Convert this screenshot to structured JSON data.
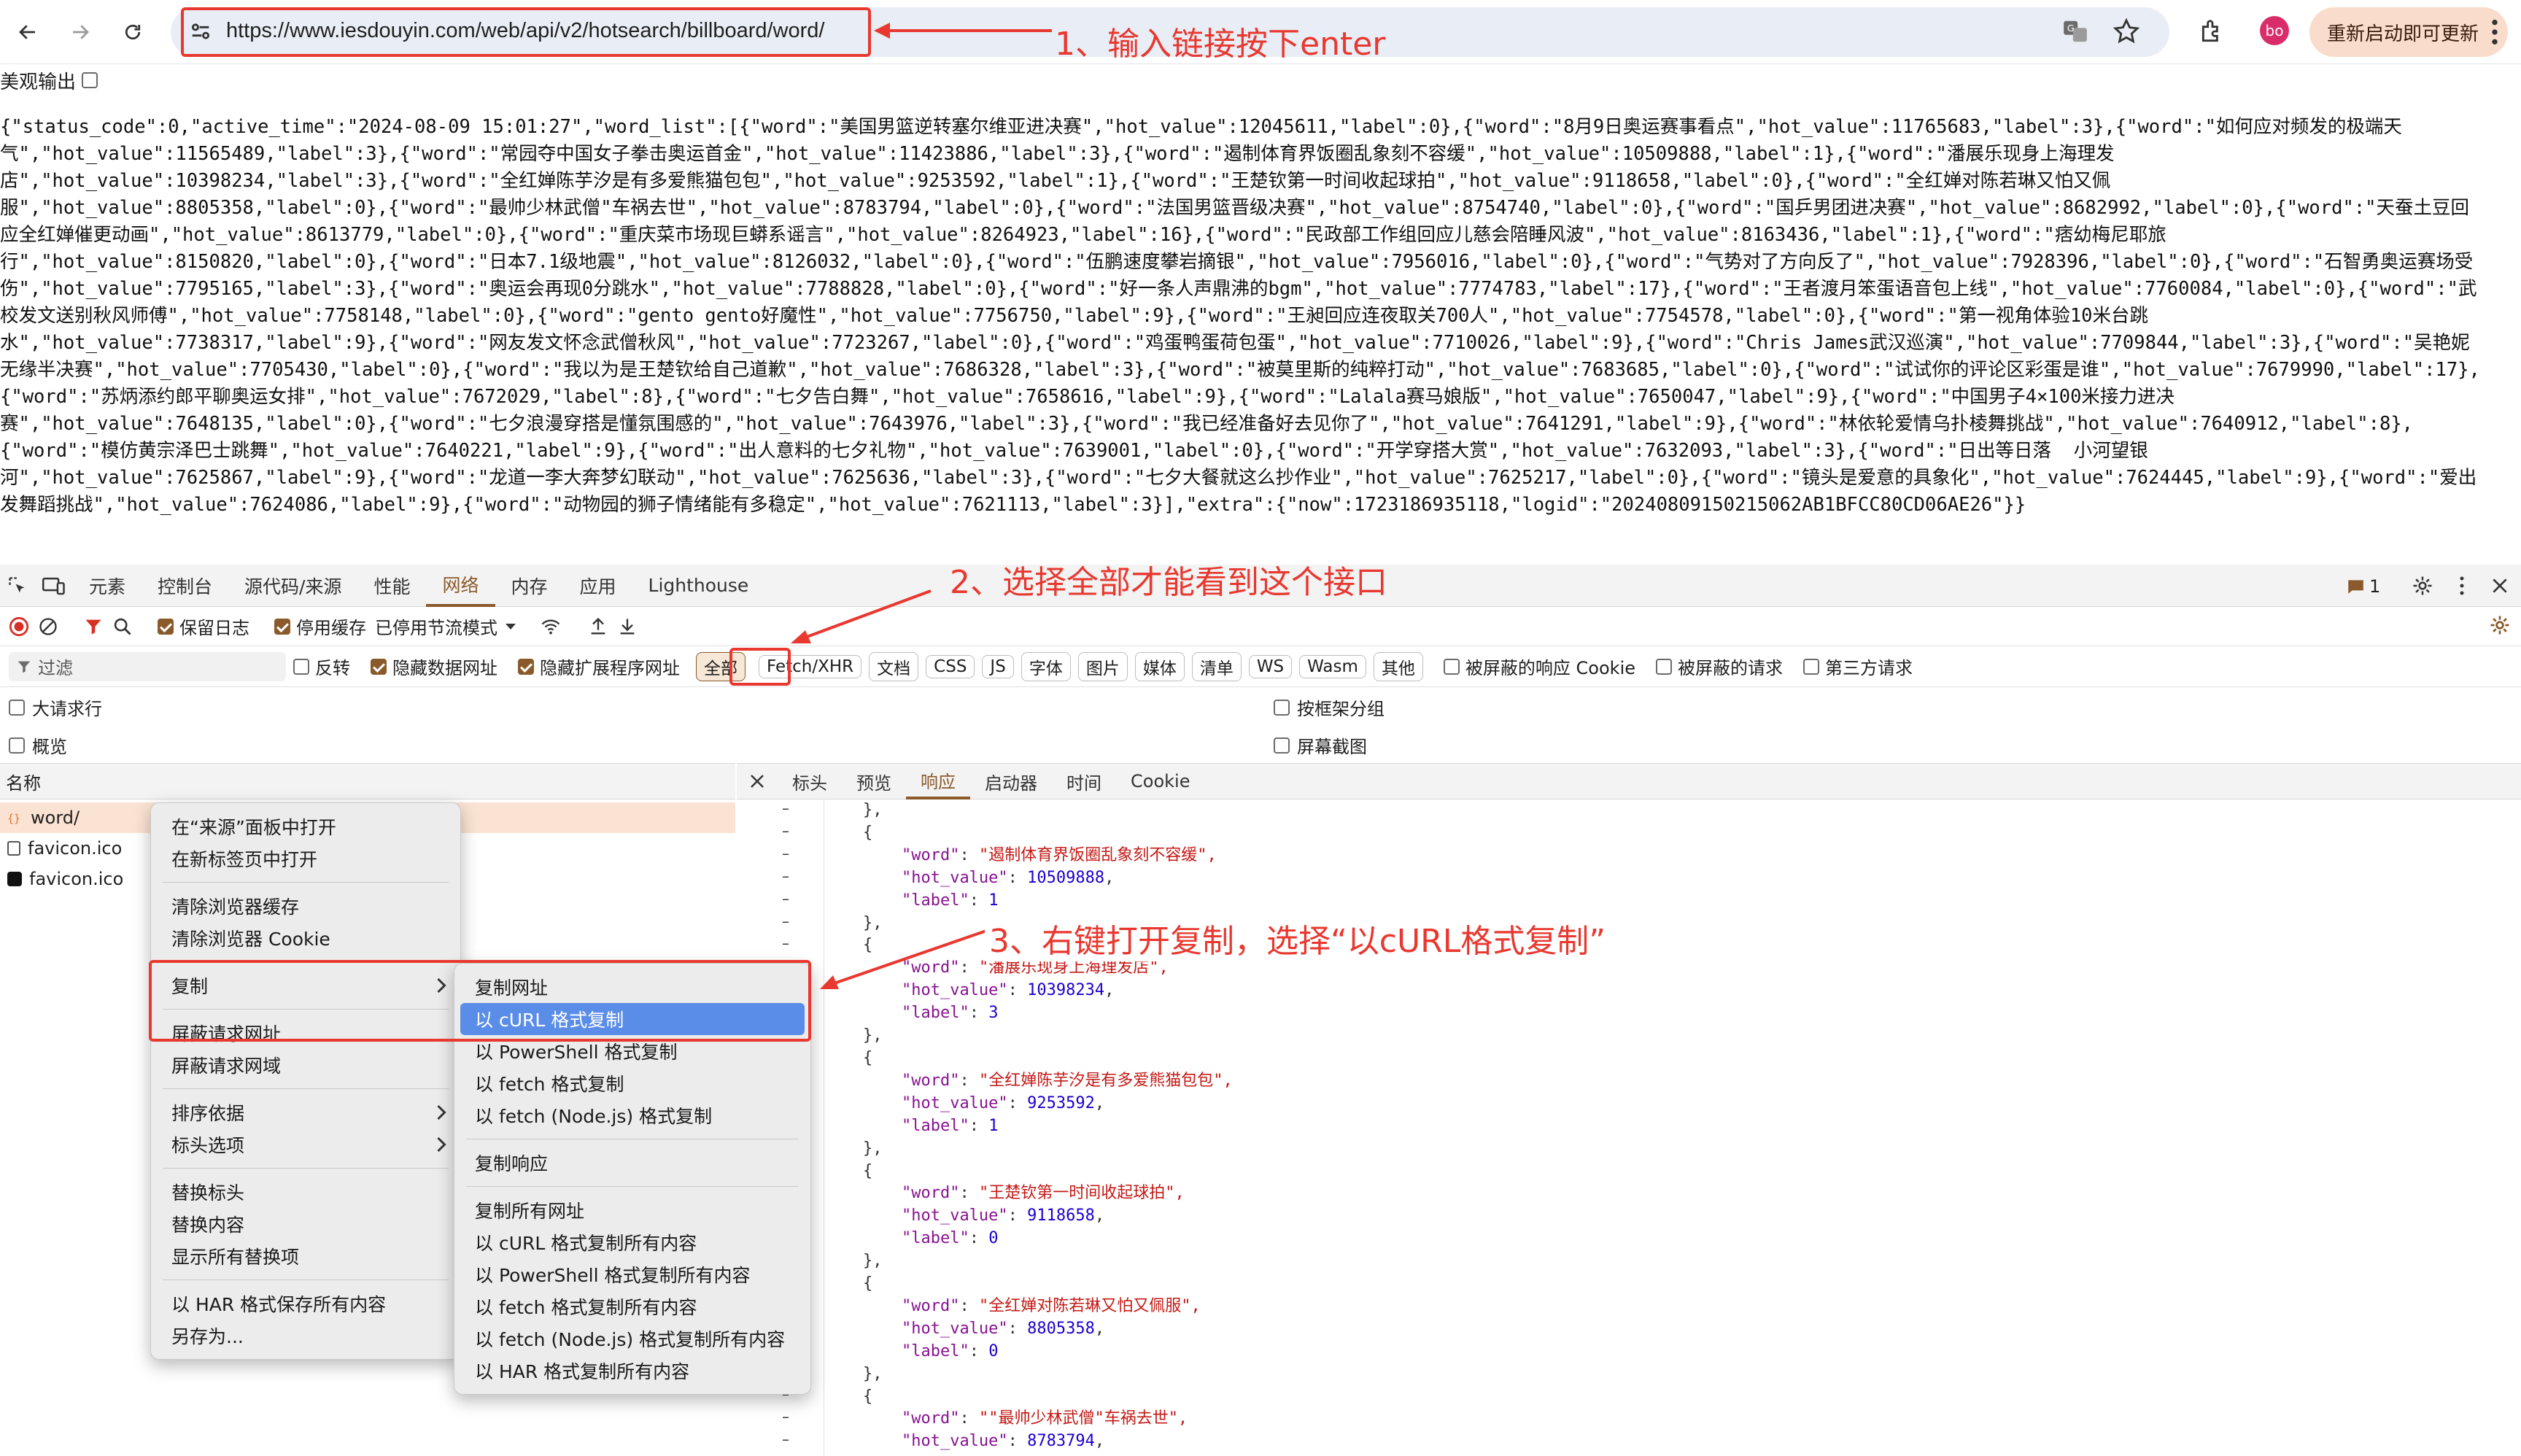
{
  "browser": {
    "url": "https://www.iesdouyin.com/web/api/v2/hotsearch/billboard/word/",
    "avatar_initials": "bo",
    "update_button": "重新启动即可更新"
  },
  "pretty_print": {
    "label": "美观输出"
  },
  "raw_json_lines": [
    "{\"status_code\":0,\"active_time\":\"2024-08-09 15:01:27\",\"word_list\":[{\"word\":\"美国男篮逆转塞尔维亚进决赛\",\"hot_value\":12045611,\"label\":0},{\"word\":\"8月9日奥运赛事看点\",\"hot_value\":11765683,\"label\":3},{\"word\":\"如何应对频发的极端天",
    "气\",\"hot_value\":11565489,\"label\":3},{\"word\":\"常园夺中国女子拳击奥运首金\",\"hot_value\":11423886,\"label\":3},{\"word\":\"遏制体育界饭圈乱象刻不容缓\",\"hot_value\":10509888,\"label\":1},{\"word\":\"潘展乐现身上海理发",
    "店\",\"hot_value\":10398234,\"label\":3},{\"word\":\"全红婵陈芋汐是有多爱熊猫包包\",\"hot_value\":9253592,\"label\":1},{\"word\":\"王楚钦第一时间收起球拍\",\"hot_value\":9118658,\"label\":0},{\"word\":\"全红婵对陈若琳又怕又佩",
    "服\",\"hot_value\":8805358,\"label\":0},{\"word\":\"最帅少林武僧\"车祸去世\",\"hot_value\":8783794,\"label\":0},{\"word\":\"法国男篮晋级决赛\",\"hot_value\":8754740,\"label\":0},{\"word\":\"国乒男团进决赛\",\"hot_value\":8682992,\"label\":0},{\"word\":\"天蚕土豆回",
    "应全红婵催更动画\",\"hot_value\":8613779,\"label\":0},{\"word\":\"重庆菜市场现巨蟒系谣言\",\"hot_value\":8264923,\"label\":16},{\"word\":\"民政部工作组回应儿慈会陪睡风波\",\"hot_value\":8163436,\"label\":1},{\"word\":\"痞幼梅尼耶旅",
    "行\",\"hot_value\":8150820,\"label\":0},{\"word\":\"日本7.1级地震\",\"hot_value\":8126032,\"label\":0},{\"word\":\"伍鹏速度攀岩摘银\",\"hot_value\":7956016,\"label\":0},{\"word\":\"气势对了方向反了\",\"hot_value\":7928396,\"label\":0},{\"word\":\"石智勇奥运赛场受",
    "伤\",\"hot_value\":7795165,\"label\":3},{\"word\":\"奥运会再现0分跳水\",\"hot_value\":7788828,\"label\":0},{\"word\":\"好一条人声鼎沸的bgm\",\"hot_value\":7774783,\"label\":17},{\"word\":\"王者渡月笨蛋语音包上线\",\"hot_value\":7760084,\"label\":0},{\"word\":\"武",
    "校发文送别秋风师傅\",\"hot_value\":7758148,\"label\":0},{\"word\":\"gento gento好魔性\",\"hot_value\":7756750,\"label\":9},{\"word\":\"王昶回应连夜取关700人\",\"hot_value\":7754578,\"label\":0},{\"word\":\"第一视角体验10米台跳",
    "水\",\"hot_value\":7738317,\"label\":9},{\"word\":\"网友发文怀念武僧秋风\",\"hot_value\":7723267,\"label\":0},{\"word\":\"鸡蛋鸭蛋荷包蛋\",\"hot_value\":7710026,\"label\":9},{\"word\":\"Chris James武汉巡演\",\"hot_value\":7709844,\"label\":3},{\"word\":\"吴艳妮",
    "无缘半决赛\",\"hot_value\":7705430,\"label\":0},{\"word\":\"我以为是王楚钦给自己道歉\",\"hot_value\":7686328,\"label\":3},{\"word\":\"被莫里斯的纯粹打动\",\"hot_value\":7683685,\"label\":0},{\"word\":\"试试你的评论区彩蛋是谁\",\"hot_value\":7679990,\"label\":17},",
    "{\"word\":\"苏炳添约郎平聊奥运女排\",\"hot_value\":7672029,\"label\":8},{\"word\":\"七夕告白舞\",\"hot_value\":7658616,\"label\":9},{\"word\":\"Lalala赛马娘版\",\"hot_value\":7650047,\"label\":9},{\"word\":\"中国男子4×100米接力进决",
    "赛\",\"hot_value\":7648135,\"label\":0},{\"word\":\"七夕浪漫穿搭是懂氛围感的\",\"hot_value\":7643976,\"label\":3},{\"word\":\"我已经准备好去见你了\",\"hot_value\":7641291,\"label\":9},{\"word\":\"林依轮爱情乌扑棱舞挑战\",\"hot_value\":7640912,\"label\":8},",
    "{\"word\":\"模仿黄宗泽巴士跳舞\",\"hot_value\":7640221,\"label\":9},{\"word\":\"出人意料的七夕礼物\",\"hot_value\":7639001,\"label\":0},{\"word\":\"开学穿搭大赏\",\"hot_value\":7632093,\"label\":3},{\"word\":\"日出等日落  小河望银",
    "河\",\"hot_value\":7625867,\"label\":9},{\"word\":\"龙道一李大奔梦幻联动\",\"hot_value\":7625636,\"label\":3},{\"word\":\"七夕大餐就这么抄作业\",\"hot_value\":7625217,\"label\":0},{\"word\":\"镜头是爱意的具象化\",\"hot_value\":7624445,\"label\":9},{\"word\":\"爱出",
    "发舞蹈挑战\",\"hot_value\":7624086,\"label\":9},{\"word\":\"动物园的狮子情绪能有多稳定\",\"hot_value\":7621113,\"label\":3}],\"extra\":{\"now\":1723186935118,\"logid\":\"20240809150215062AB1BFCC80CD06AE26\"}}"
  ],
  "devtools": {
    "tabs": [
      "元素",
      "控制台",
      "源代码/来源",
      "性能",
      "网络",
      "内存",
      "应用",
      "Lighthouse"
    ],
    "active_tab": "网络",
    "issues_count": "1",
    "toolbar": {
      "preserve_log": "保留日志",
      "disable_cache": "停用缓存",
      "throttle": "已停用节流模式"
    },
    "filter": {
      "placeholder": "过滤",
      "invert": "反转",
      "hide_data_urls": "隐藏数据网址",
      "hide_ext_urls": "隐藏扩展程序网址",
      "types": [
        "全部",
        "Fetch/XHR",
        "文档",
        "CSS",
        "JS",
        "字体",
        "图片",
        "媒体",
        "清单",
        "WS",
        "Wasm",
        "其他"
      ],
      "blocked_cookies": "被屏蔽的响应 Cookie",
      "blocked_requests": "被屏蔽的请求",
      "third_party": "第三方请求"
    },
    "options": {
      "big_rows": "大请求行",
      "overview": "概览",
      "group_by_frame": "按框架分组",
      "screenshots": "屏幕截图"
    },
    "list_header": "名称",
    "requests": [
      "word/",
      "favicon.ico",
      "favicon.ico"
    ],
    "detail_tabs": [
      "标头",
      "预览",
      "响应",
      "启动器",
      "时间",
      "Cookie"
    ],
    "active_detail_tab": "响应",
    "response_items": [
      {
        "word": "遏制体育界饭圈乱象刻不容缓",
        "hot_value": "10509888",
        "label": "1"
      },
      {
        "word": "潘展乐现身上海理发店",
        "hot_value": "10398234",
        "label": "3"
      },
      {
        "word": "全红婵陈芋汐是有多爱熊猫包包",
        "hot_value": "9253592",
        "label": "1"
      },
      {
        "word": "王楚钦第一时间收起球拍",
        "hot_value": "9118658",
        "label": "0"
      },
      {
        "word": "全红婵对陈若琳又怕又佩服",
        "hot_value": "8805358",
        "label": "0"
      },
      {
        "word": "\"最帅少林武僧\"车祸去世",
        "hot_value": "8783794",
        "label": "0"
      }
    ]
  },
  "context_menu": {
    "items": [
      "在“来源”面板中打开",
      "在新标签页中打开",
      "清除浏览器缓存",
      "清除浏览器 Cookie",
      "复制",
      "屏蔽请求网址",
      "屏蔽请求网域",
      "排序依据",
      "标头选项",
      "替换标头",
      "替换内容",
      "显示所有替换项",
      "以 HAR 格式保存所有内容",
      "另存为..."
    ]
  },
  "copy_submenu": {
    "items": [
      "复制网址",
      "以 cURL 格式复制",
      "以 PowerShell 格式复制",
      "以 fetch 格式复制",
      "以 fetch (Node.js) 格式复制",
      "复制响应",
      "复制所有网址",
      "以 cURL 格式复制所有内容",
      "以 PowerShell 格式复制所有内容",
      "以 fetch 格式复制所有内容",
      "以 fetch (Node.js) 格式复制所有内容",
      "以 HAR 格式复制所有内容"
    ],
    "highlighted": "以 cURL 格式复制"
  },
  "annotations": {
    "step1": "1、输入链接按下enter",
    "step2": "2、选择全部才能看到这个接口",
    "step3": "3、右键打开复制，选择“以cURL格式复制”",
    "color": "#e8382f"
  },
  "colors": {
    "accent": "#8a5a2b",
    "menu_highlight": "#5a8de8"
  }
}
